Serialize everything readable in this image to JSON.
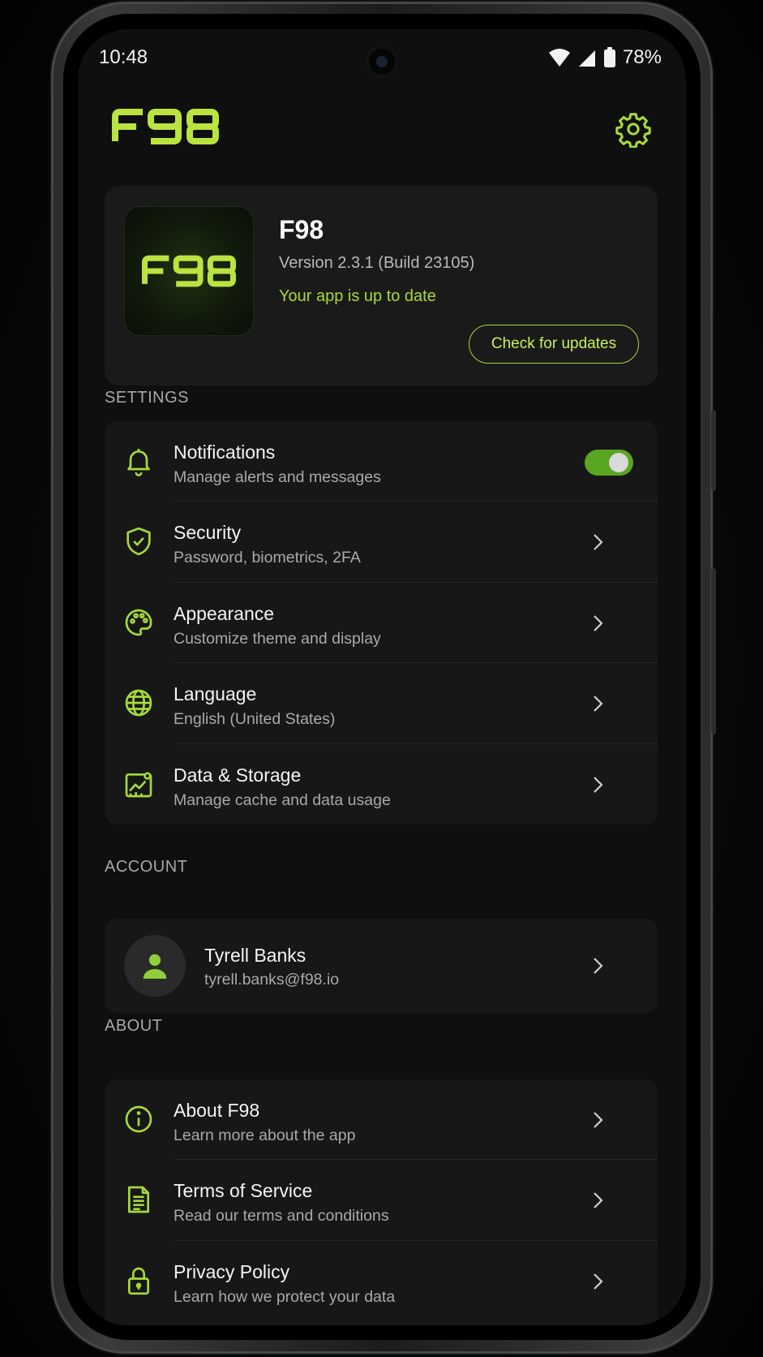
{
  "status_bar": {
    "time": "10:48",
    "battery": "78%"
  },
  "header": {
    "logo_text": "F98"
  },
  "app_info": {
    "icon_text": "F98",
    "name": "F98",
    "version": "Version 2.3.1 (Build 23105)",
    "status": "Your app is up to date",
    "update_button": "Check for updates"
  },
  "settings": {
    "label": "SETTINGS",
    "items": [
      {
        "title": "Notifications",
        "subtitle": "Manage alerts and messages",
        "icon": "bell-icon",
        "toggle_on": true
      },
      {
        "title": "Security",
        "subtitle": "Password, biometrics, 2FA",
        "icon": "shield-check-icon"
      },
      {
        "title": "Appearance",
        "subtitle": "Customize theme and display",
        "icon": "palette-icon"
      },
      {
        "title": "Language",
        "subtitle": "English (United States)",
        "icon": "globe-icon"
      },
      {
        "title": "Data & Storage",
        "subtitle": "Manage cache and data usage",
        "icon": "chart-icon"
      }
    ]
  },
  "account": {
    "label": "ACCOUNT",
    "name": "Tyrell Banks",
    "email": "tyrell.banks@f98.io"
  },
  "about": {
    "label": "ABOUT",
    "items": [
      {
        "title": "About F98",
        "subtitle": "Learn more about the app",
        "icon": "info-icon"
      },
      {
        "title": "Terms of Service",
        "subtitle": "Read our terms and conditions",
        "icon": "document-icon"
      },
      {
        "title": "Privacy Policy",
        "subtitle": "Learn how we protect your data",
        "icon": "lock-icon"
      }
    ]
  },
  "colors": {
    "accent": "#a6d93b",
    "toggle": "#5aa521",
    "background": "#0f0f0f",
    "card": "#171717"
  }
}
